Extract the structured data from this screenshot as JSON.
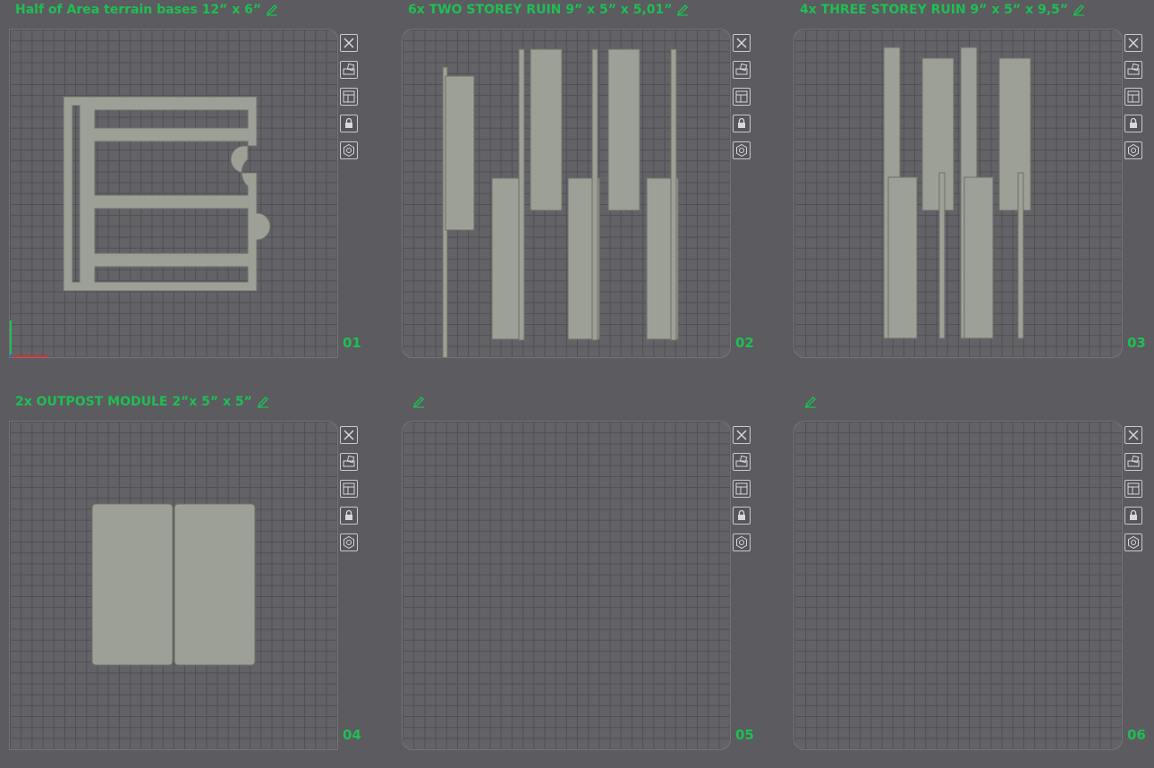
{
  "plates": [
    {
      "title": "Half of Area terrain bases 12” x 6”",
      "number": "01"
    },
    {
      "title": "6x TWO STOREY RUIN 9” x 5” x 5,01”",
      "number": "02"
    },
    {
      "title": "4x THREE STOREY RUIN 9” x 5” x 9,5”",
      "number": "03"
    },
    {
      "title": "2x OUTPOST MODULE 2”x 5” x 5”",
      "number": "04"
    },
    {
      "title": "",
      "number": "05"
    },
    {
      "title": "",
      "number": "06"
    }
  ],
  "colors": {
    "accent": "#1fbf52",
    "background": "#5b5b60",
    "plate": "#626267",
    "model": "#9da096"
  },
  "toolbar_icons": [
    "close-icon",
    "auto-orient-icon",
    "arrange-icon",
    "lock-icon",
    "settings-icon"
  ]
}
